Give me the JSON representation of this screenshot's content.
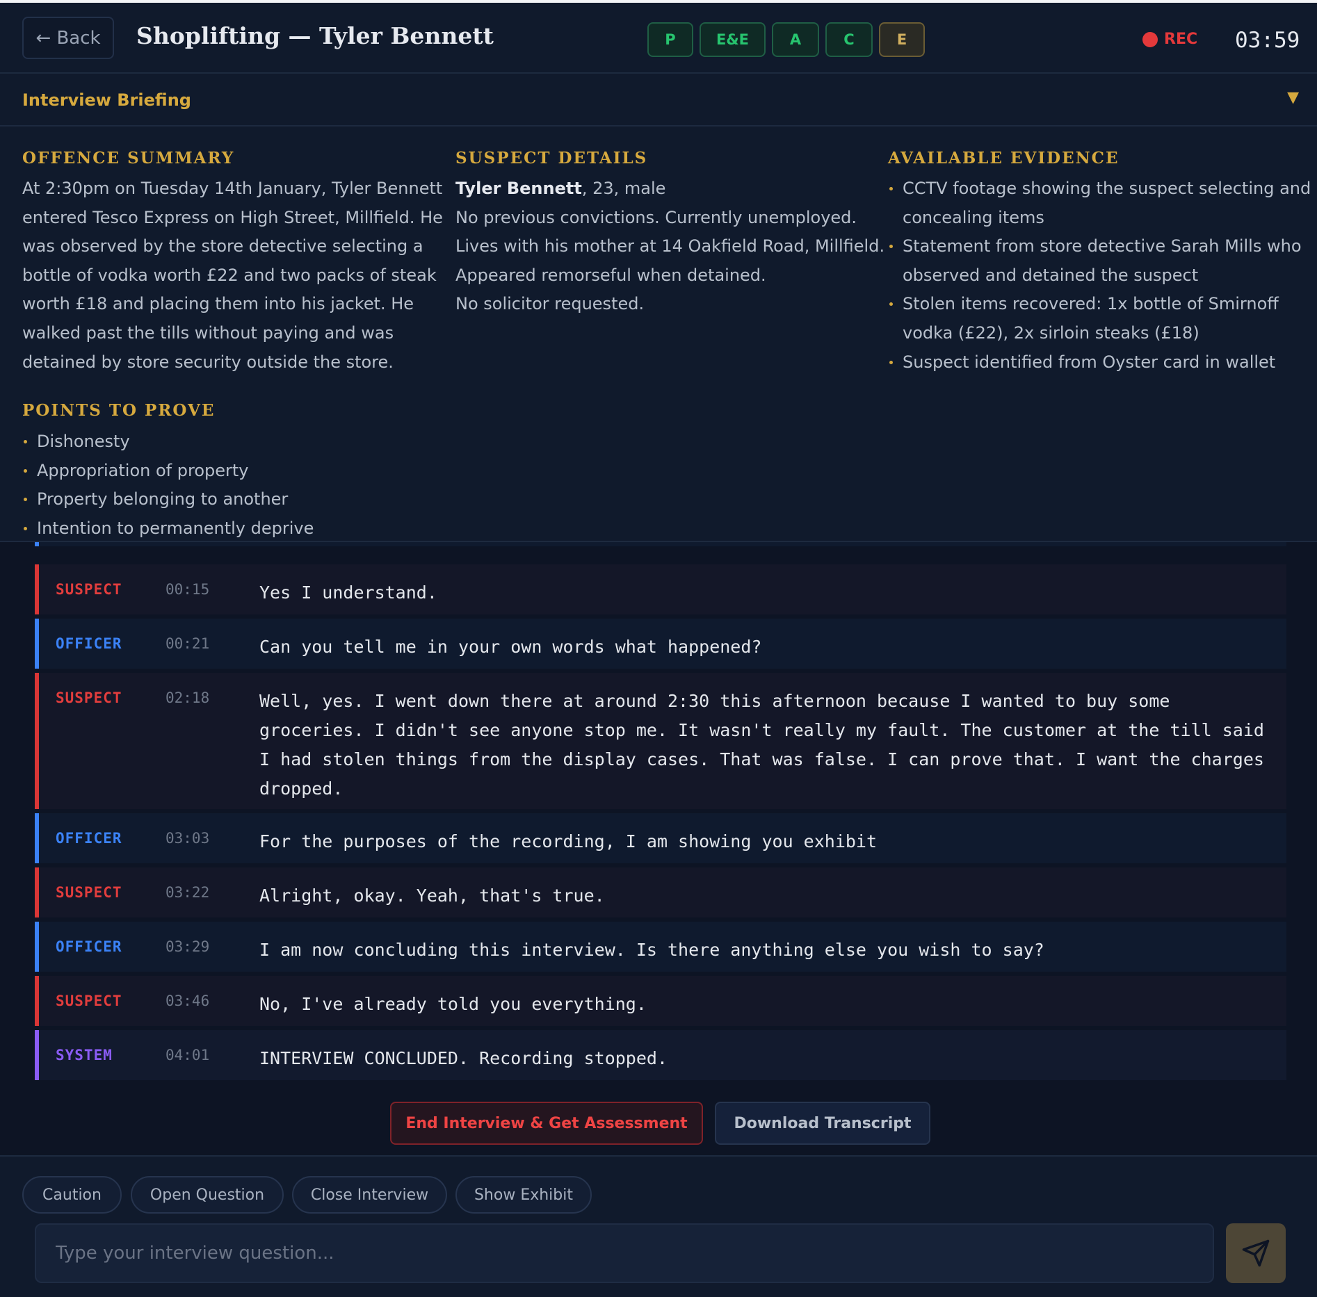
{
  "header": {
    "back_label": "← Back",
    "title": "Shoplifting — Tyler Bennett",
    "pace_steps": [
      "P",
      "E&E",
      "A",
      "C",
      "E"
    ],
    "rec_label": "REC",
    "timer": "03:59"
  },
  "briefing": {
    "title": "Interview Briefing",
    "toggle_icon": "chevron-down",
    "offence": {
      "heading": "OFFENCE SUMMARY",
      "lines": [
        "At 2:30pm on Tuesday 14th January, Tyler Bennett",
        "entered Tesco Express on High Street, Millfield. He",
        "was observed by the store detective selecting a",
        "bottle of vodka worth £22 and two packs of steak",
        "worth £18 and placing them into his jacket. He",
        "walked past the tills without paying and was",
        "detained by store security outside the store."
      ]
    },
    "suspect": {
      "heading": "SUSPECT DETAILS",
      "name": "Tyler Bennett",
      "name_suffix": ", 23, male",
      "lines": [
        "No previous convictions. Currently unemployed.",
        "Lives with his mother at 14 Oakfield Road, Millfield.",
        "Appeared remorseful when detained.",
        "No solicitor requested."
      ]
    },
    "evidence": {
      "heading": "AVAILABLE EVIDENCE",
      "items": [
        [
          "CCTV footage showing the suspect selecting and",
          "concealing items"
        ],
        [
          "Statement from store detective Sarah Mills who",
          "observed and detained the suspect"
        ],
        [
          "Stolen items recovered: 1x bottle of Smirnoff",
          "vodka (£22), 2x sirloin steaks (£18)"
        ],
        [
          "Suspect identified from Oyster card in wallet"
        ]
      ]
    },
    "points": {
      "heading": "POINTS TO PROVE",
      "items": [
        "Dishonesty",
        "Appropriation of property",
        "Property belonging to another",
        "Intention to permanently deprive"
      ]
    }
  },
  "transcript": [
    {
      "speaker": "SUSPECT",
      "time": "00:15",
      "text": "Yes I understand."
    },
    {
      "speaker": "OFFICER",
      "time": "00:21",
      "text": "Can you tell me in your own words what happened?"
    },
    {
      "speaker": "SUSPECT",
      "time": "02:18",
      "text": "Well, yes. I went down there at around 2:30 this afternoon because I wanted to buy some groceries. I didn't see anyone stop me. It wasn't really my fault. The customer at the till said I had stolen things from the display cases. That was false. I can prove that. I want the charges dropped."
    },
    {
      "speaker": "OFFICER",
      "time": "03:03",
      "text": "For the purposes of the recording, I am showing you exhibit"
    },
    {
      "speaker": "SUSPECT",
      "time": "03:22",
      "text": "Alright, okay. Yeah, that's true."
    },
    {
      "speaker": "OFFICER",
      "time": "03:29",
      "text": "I am now concluding this interview. Is there anything else you wish to say?"
    },
    {
      "speaker": "SUSPECT",
      "time": "03:46",
      "text": "No, I've already told you everything."
    },
    {
      "speaker": "SYSTEM",
      "time": "04:01",
      "text": "INTERVIEW CONCLUDED. Recording stopped."
    }
  ],
  "actions": {
    "end_label": "End Interview & Get Assessment",
    "download_label": "Download Transcript"
  },
  "quick_actions": [
    "Caution",
    "Open Question",
    "Close Interview",
    "Show Exhibit"
  ],
  "composer": {
    "placeholder": "Type your interview question...",
    "send_icon": "send-icon"
  },
  "colors": {
    "background": "#0d1424",
    "accent_gold": "#d6a93e",
    "suspect_red": "#e23d3d",
    "officer_blue": "#3b82f6",
    "system_purple": "#8b5cf6",
    "pill_green": "#27c56f"
  }
}
